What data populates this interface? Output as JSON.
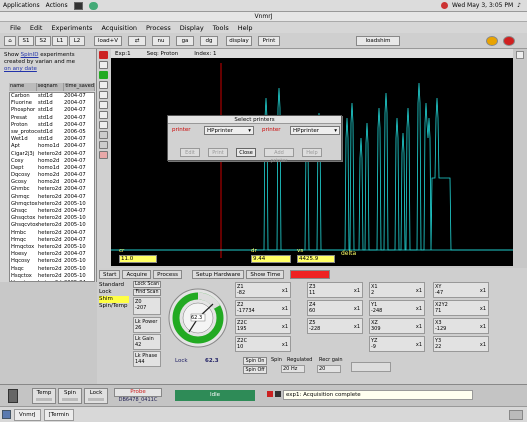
{
  "topbar": {
    "applications": "Applications",
    "actions": "Actions",
    "clock": "Wed May 3, 3:05 PM"
  },
  "window": {
    "title": "VnmrJ"
  },
  "menu": [
    "File",
    "Edit",
    "Experiments",
    "Acquisition",
    "Process",
    "Display",
    "Tools",
    "Help"
  ],
  "toolbar": {
    "b1": "S1",
    "b2": "S2",
    "b3": "L1",
    "b4": "L2",
    "b5": "load+V",
    "b6": "nu",
    "b7": "ga",
    "b8": "dg",
    "b9": "display",
    "b10": "Print",
    "b11": "loadshim"
  },
  "left": {
    "show_prefix": "Show",
    "show_link": "SpinID",
    "show_rest": "experiments",
    "created_line": "created by varian and me",
    "on_any_date": "on any date",
    "columns": [
      "name",
      "seqnam",
      "time_saved"
    ],
    "rows": [
      [
        "Carbon",
        "std1d",
        "2004-07"
      ],
      [
        "Fluorine",
        "std1d",
        "2004-07"
      ],
      [
        "Phosphor",
        "std1d",
        "2004-07"
      ],
      [
        "Presat",
        "std1d",
        "2004-07"
      ],
      [
        "Proton",
        "std1d",
        "2004-07"
      ],
      [
        "sw_protocol",
        "std1d",
        "2006-05"
      ],
      [
        "Wet1d",
        "std1d",
        "2004-07"
      ],
      [
        "Apt",
        "homo1d",
        "2004-07"
      ],
      [
        "Cigar2j3j",
        "hetero2d",
        "2004-07"
      ],
      [
        "Cosy",
        "homo2d",
        "2004-07"
      ],
      [
        "Dept",
        "homo1d",
        "2004-07"
      ],
      [
        "Dqcosy",
        "homo2d",
        "2004-07"
      ],
      [
        "Gcosy",
        "homo2d",
        "2004-07"
      ],
      [
        "Ghmbc",
        "hetero2d",
        "2004-07"
      ],
      [
        "Ghmqc",
        "hetero2d",
        "2004-07"
      ],
      [
        "Ghmqctox",
        "hetero2d",
        "2005-10"
      ],
      [
        "Ghsqc",
        "hetero2d",
        "2004-07"
      ],
      [
        "Ghsqctox",
        "hetero2d",
        "2005-10"
      ],
      [
        "Ghsqcvtox",
        "hetero2d",
        "2005-10"
      ],
      [
        "Hmbc",
        "hetero2d",
        "2004-07"
      ],
      [
        "Hmqc",
        "hetero2d",
        "2004-07"
      ],
      [
        "Hmqctox",
        "hetero2d",
        "2005-10"
      ],
      [
        "Hoesy",
        "hetero2d",
        "2004-07"
      ],
      [
        "Hqcosy",
        "hetero2d",
        "2005-10"
      ],
      [
        "Hsqc",
        "hetero2d",
        "2005-10"
      ],
      [
        "Hsqctox",
        "hetero2d",
        "2005-10"
      ],
      [
        "Hsqctoxyphase",
        "hetero2d",
        "2005-04"
      ],
      [
        "Hsqcvtox",
        "hetero2d",
        "2005-10"
      ],
      [
        "Noesy",
        "homo2d",
        "2004-07"
      ]
    ]
  },
  "spectrum": {
    "message": "exp1: Acquisition complete",
    "info": [
      "Exp:1",
      "Seq: Proton",
      "Index: 1"
    ],
    "cr_label": "cr",
    "cr_value": "11.0",
    "dr_label": "dr",
    "dr_value": "9.44",
    "vs_label": "vs",
    "vs_value": "4425.9",
    "delta": "delta"
  },
  "dialog": {
    "title": "Select printers",
    "printer_label": "printer",
    "printer_value": "HPprinter",
    "plotter_label": "printer",
    "plotter_value": "HPprinter",
    "buttons": [
      "Edit",
      "Print",
      "Close",
      "Add printer",
      "Help"
    ]
  },
  "bottom": {
    "tabs": [
      "Start",
      "Acquire",
      "Process",
      "Setup Hardware",
      "Show Time"
    ],
    "red_label": "Stop",
    "side_labels": [
      "Standard",
      "Lock",
      "Shim",
      "Spin/Temp"
    ],
    "lock_scan": "Lock Scan",
    "find_scan": "Find Scan",
    "z0_label": "Z0",
    "z0_value": "-207",
    "lock_power_label": "Lk Power",
    "lock_power_value": "26",
    "lock_gain_label": "Lk Gain",
    "lock_gain_value": "42",
    "lock_phase_label": "Lk Phase",
    "lock_phase_value": "144",
    "gauge_value": "62.3",
    "lock_label": "Lock",
    "shims": [
      [
        "Z1",
        "-82"
      ],
      [
        "Z2",
        "-17734"
      ],
      [
        "Z2C",
        "195"
      ],
      [
        "Z2C",
        "10"
      ],
      [
        "Z3",
        "11"
      ],
      [
        "Z4",
        "60"
      ],
      [
        "Z5",
        "-228"
      ],
      [
        "X1",
        "2"
      ],
      [
        "Y1",
        "-248"
      ],
      [
        "XZ",
        "309"
      ],
      [
        "YZ",
        "-9"
      ],
      [
        "XY",
        "-47"
      ],
      [
        "X2Y2",
        "71"
      ],
      [
        "X3",
        "-129"
      ],
      [
        "Y3",
        "22"
      ]
    ],
    "spin_on": "Spin On",
    "spin_off": "Spin Off",
    "spin_label": "Spin",
    "spin_value": "20 Hz",
    "regulated_label": "Regulated",
    "recr_gain_label": "Recr gain",
    "recr_gain_value": "20"
  },
  "status": {
    "temp": "Temp",
    "spin": "Spin",
    "lock": "Lock",
    "probe": "Probe",
    "probe_id": "DB6478_0411C",
    "idle": "Idle",
    "message": "exp1: Acquisition complete"
  },
  "taskbar": {
    "items": [
      "VnmrJ",
      "[Termin"
    ]
  }
}
